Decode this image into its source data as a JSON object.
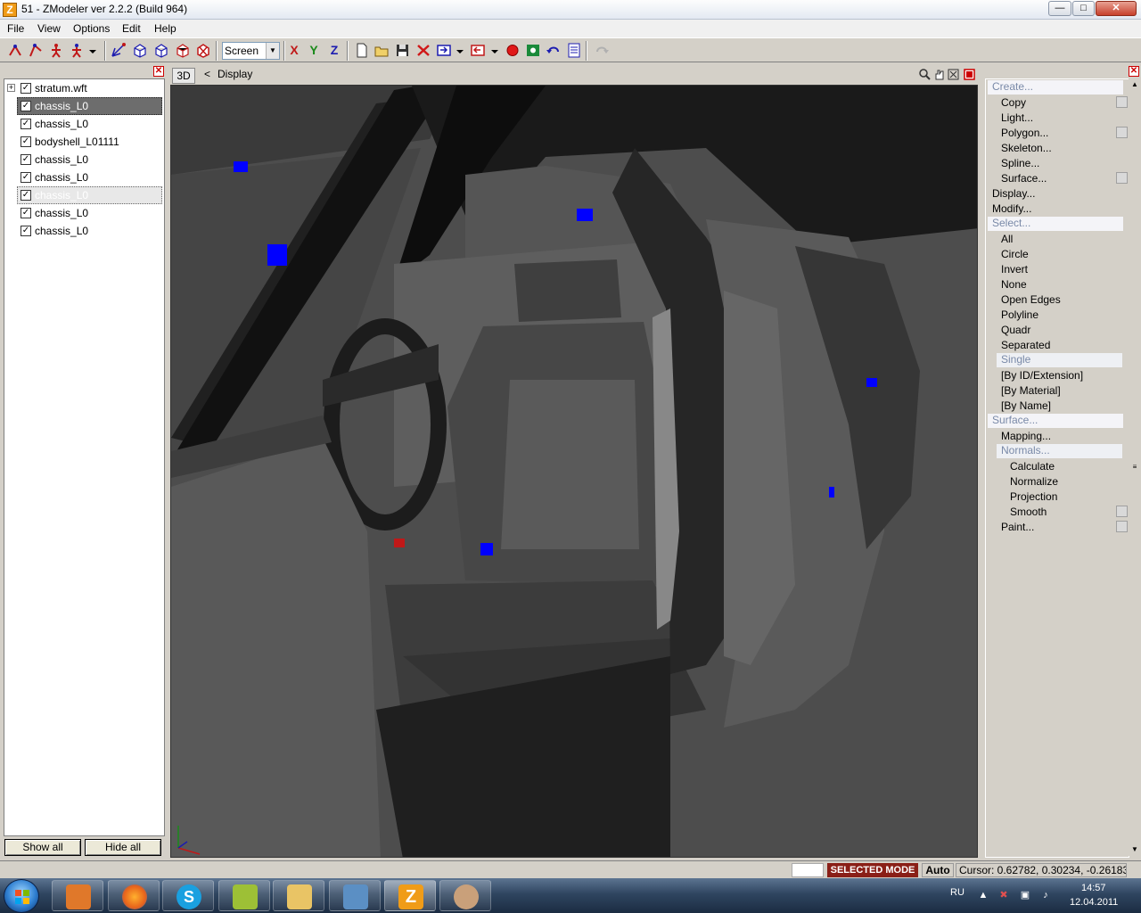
{
  "window": {
    "title": "51 - ZModeler ver 2.2.2 (Build 964)",
    "app_icon_letter": "Z",
    "min_label": "—",
    "max_label": "□",
    "close_label": "✕"
  },
  "menu": [
    "File",
    "View",
    "Options",
    "Edit",
    "Help"
  ],
  "toolbar": {
    "view_select": "Screen",
    "axes": [
      "X",
      "Y",
      "Z"
    ]
  },
  "scene_tree": {
    "close_label": "✕",
    "items": [
      {
        "label": "stratum.wft",
        "checked": true,
        "expander": "+"
      },
      {
        "label": "chassis_L0",
        "checked": true,
        "state": "selected"
      },
      {
        "label": "chassis_L0",
        "checked": true
      },
      {
        "label": "bodyshell_L01111",
        "checked": true
      },
      {
        "label": "chassis_L0",
        "checked": true
      },
      {
        "label": "chassis_L0",
        "checked": true
      },
      {
        "label": "chassis_L0",
        "checked": true,
        "state": "highlighted"
      },
      {
        "label": "chassis_L0",
        "checked": true
      },
      {
        "label": "chassis_L0",
        "checked": true
      }
    ],
    "show_all": "Show all",
    "hide_all": "Hide all"
  },
  "viewport": {
    "view_tag": "3D",
    "back_arrow": "<",
    "mode_label": "Display",
    "colors": {
      "background": "#4d4d4d",
      "body": "#5a5a5a",
      "marker": "#0000ff"
    }
  },
  "commands": {
    "close_label": "✕",
    "items": [
      {
        "label": "Create...",
        "kind": "header"
      },
      {
        "label": "Copy",
        "indent": 1,
        "check": true
      },
      {
        "label": "Light...",
        "indent": 1
      },
      {
        "label": "Polygon...",
        "indent": 1,
        "check": true
      },
      {
        "label": "Skeleton...",
        "indent": 1
      },
      {
        "label": "Spline...",
        "indent": 1
      },
      {
        "label": "Surface...",
        "indent": 1,
        "check": true
      },
      {
        "label": "Display...",
        "indent": 0
      },
      {
        "label": "Modify...",
        "indent": 0
      },
      {
        "label": "Select...",
        "kind": "header"
      },
      {
        "label": "All",
        "indent": 1
      },
      {
        "label": "Circle",
        "indent": 1
      },
      {
        "label": "Invert",
        "indent": 1
      },
      {
        "label": "None",
        "indent": 1
      },
      {
        "label": "Open Edges",
        "indent": 1
      },
      {
        "label": "Polyline",
        "indent": 1
      },
      {
        "label": "Quadr",
        "indent": 1
      },
      {
        "label": "Separated",
        "indent": 1
      },
      {
        "label": "Single",
        "indent": 1,
        "kind": "highlight"
      },
      {
        "label": "[By ID/Extension]",
        "indent": 1
      },
      {
        "label": "[By Material]",
        "indent": 1
      },
      {
        "label": "[By Name]",
        "indent": 1
      },
      {
        "label": "Surface...",
        "kind": "header"
      },
      {
        "label": "Mapping...",
        "indent": 1
      },
      {
        "label": "Normals...",
        "indent": 1,
        "kind": "highlight"
      },
      {
        "label": "Calculate",
        "indent": 2
      },
      {
        "label": "Normalize",
        "indent": 2
      },
      {
        "label": "Projection",
        "indent": 2
      },
      {
        "label": "Smooth",
        "indent": 2,
        "check": true
      },
      {
        "label": "Paint...",
        "indent": 1,
        "check": true
      }
    ]
  },
  "status": {
    "mode": "SELECTED MODE",
    "auto": "Auto",
    "cursor": "Cursor: 0.62782, 0.30234, -0.26183"
  },
  "taskbar": {
    "language": "RU",
    "time": "14:57",
    "date": "12.04.2011",
    "apps": [
      {
        "name": "media-player",
        "color": "#e0782a"
      },
      {
        "name": "firefox",
        "color": "#e8641b"
      },
      {
        "name": "skype",
        "color": "#1aa0e0"
      },
      {
        "name": "joystick-app",
        "color": "#9dc036"
      },
      {
        "name": "folder",
        "color": "#e9c465"
      },
      {
        "name": "picture-viewer",
        "color": "#5b8fc4"
      },
      {
        "name": "zmodeler",
        "color": "#f09c18"
      },
      {
        "name": "paint",
        "color": "#c9a07a"
      }
    ]
  }
}
